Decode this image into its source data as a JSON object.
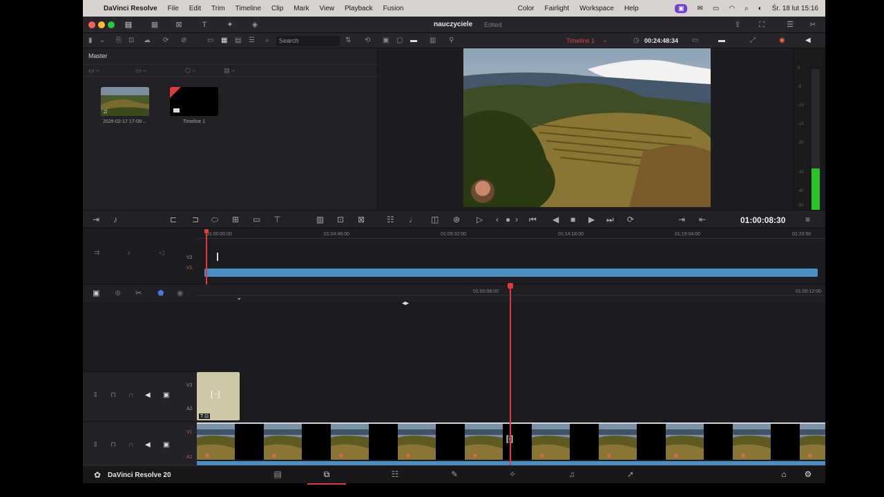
{
  "menubar": {
    "app_name": "DaVinci Resolve",
    "menus": [
      "File",
      "Edit",
      "Trim",
      "Timeline",
      "Clip",
      "Mark",
      "View",
      "Playback",
      "Fusion"
    ],
    "right_menus": [
      "Color",
      "Fairlight",
      "Workspace",
      "Help"
    ],
    "clock": "Śr. 18 lut  15:16"
  },
  "window": {
    "project_title": "nauczyciele",
    "status": "Edited"
  },
  "toolbar": {
    "search_placeholder": "Search",
    "timeline_name": "Timeline 1",
    "duration_timecode": "00:24:48:34"
  },
  "media_pool": {
    "label": "Master",
    "clips": [
      {
        "name": "2026-02-17 17-09-..."
      },
      {
        "name": "Timeline 1"
      }
    ]
  },
  "audio_meter": {
    "scale": [
      "0",
      "-5",
      "-10",
      "-15",
      "-20",
      "-30",
      "-40",
      "-50"
    ]
  },
  "transport": {
    "timecode": "01:00:08:30"
  },
  "upper_timeline": {
    "ruler": [
      "01:00:00:00",
      "01:04:46:00",
      "01:09:32:00",
      "01:14:18:00",
      "01:19:04:00",
      "01:23:50"
    ],
    "tracks": [
      "V2",
      "V1"
    ]
  },
  "lower_timeline": {
    "ruler": [
      "01:00:08:00",
      "01:00:12:00"
    ],
    "tracks": [
      {
        "video": "V2",
        "audio": "A2"
      },
      {
        "video": "V1",
        "audio": "A1"
      }
    ]
  },
  "pagebar": {
    "brand": "DaVinci Resolve 20",
    "pages": [
      "media",
      "cut",
      "edit",
      "fusion",
      "color",
      "fairlight",
      "deliver"
    ],
    "active_page": "cut"
  },
  "colors": {
    "playhead": "#e03a3a",
    "audio_clip": "#4a8ec4",
    "active_tab": "#e03a3a"
  }
}
